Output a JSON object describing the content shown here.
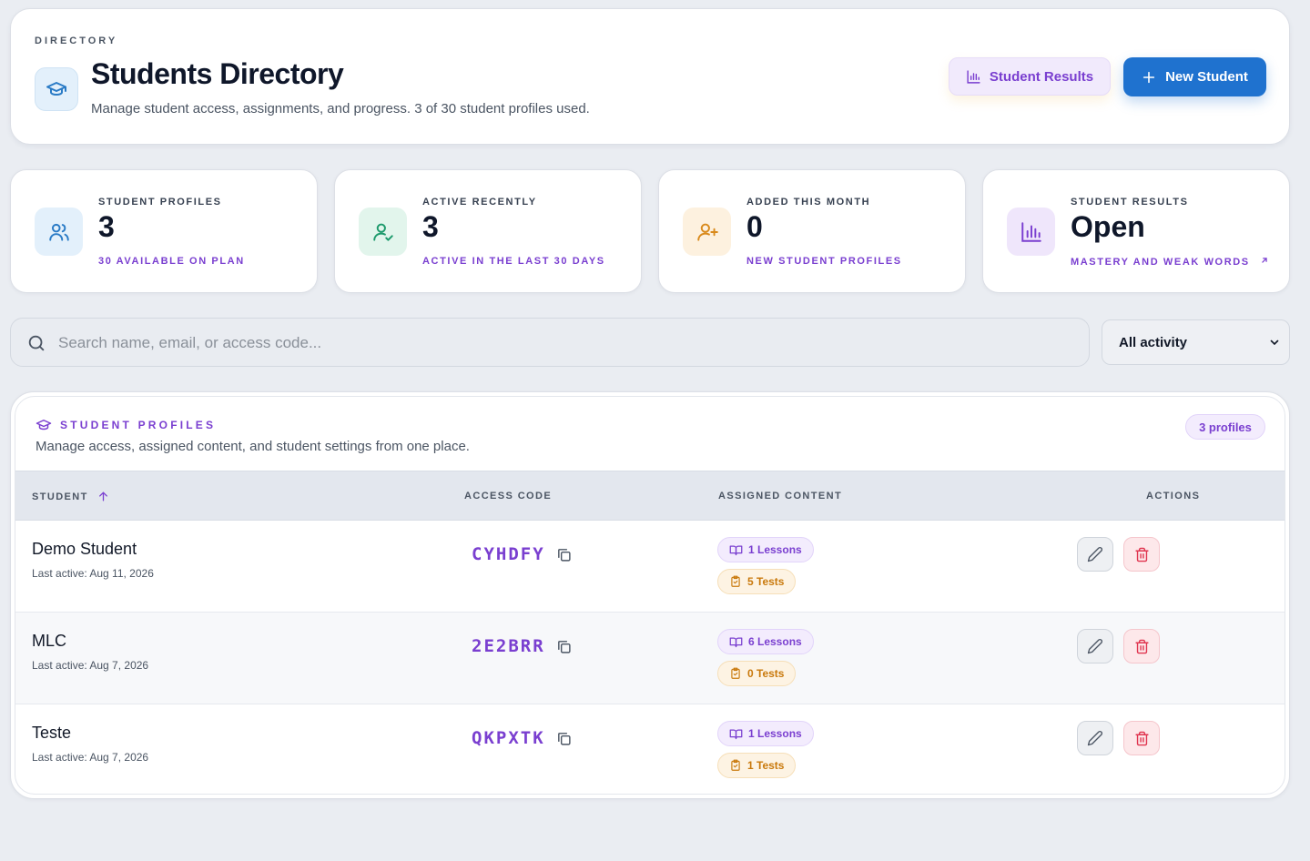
{
  "header": {
    "eyebrow": "DIRECTORY",
    "title": "Students Directory",
    "subtitle": "Manage student access, assignments, and progress. 3 of 30 student profiles used.",
    "results_button": "Student Results",
    "new_button": "New Student"
  },
  "stats": [
    {
      "label": "STUDENT PROFILES",
      "value": "3",
      "sub": "30 AVAILABLE ON PLAN",
      "icon": "users-icon",
      "color": "#2a7bc6"
    },
    {
      "label": "ACTIVE RECENTLY",
      "value": "3",
      "sub": "ACTIVE IN THE LAST 30 DAYS",
      "icon": "user-check-icon",
      "color": "#1d9a6c"
    },
    {
      "label": "ADDED THIS MONTH",
      "value": "0",
      "sub": "NEW STUDENT PROFILES",
      "icon": "user-plus-icon",
      "color": "#d98a1c"
    },
    {
      "label": "STUDENT RESULTS",
      "value": "Open",
      "sub": "MASTERY AND WEAK WORDS",
      "icon": "bar-chart-icon",
      "color": "#7a3fd0"
    }
  ],
  "search": {
    "placeholder": "Search name, email, or access code..."
  },
  "filter": {
    "selected": "All activity"
  },
  "table": {
    "title": "STUDENT PROFILES",
    "description": "Manage access, assigned content, and student settings from one place.",
    "count": "3 profiles",
    "columns": {
      "student": "STUDENT",
      "code": "ACCESS CODE",
      "content": "ASSIGNED CONTENT",
      "actions": "ACTIONS"
    },
    "rows": [
      {
        "name": "Demo Student",
        "last_active": "Last active: Aug 11, 2026",
        "code": "CYHDFY",
        "lessons": "1 Lessons",
        "tests": "5 Tests"
      },
      {
        "name": "MLC",
        "last_active": "Last active: Aug 7, 2026",
        "code": "2E2BRR",
        "lessons": "6 Lessons",
        "tests": "0 Tests"
      },
      {
        "name": "Teste",
        "last_active": "Last active: Aug 7, 2026",
        "code": "QKPXTK",
        "lessons": "1 Lessons",
        "tests": "1 Tests"
      }
    ]
  },
  "colors": {
    "accent": "#7a3fd0",
    "primary": "#1f72cf",
    "danger": "#e0344f",
    "warning": "#c9790c"
  }
}
